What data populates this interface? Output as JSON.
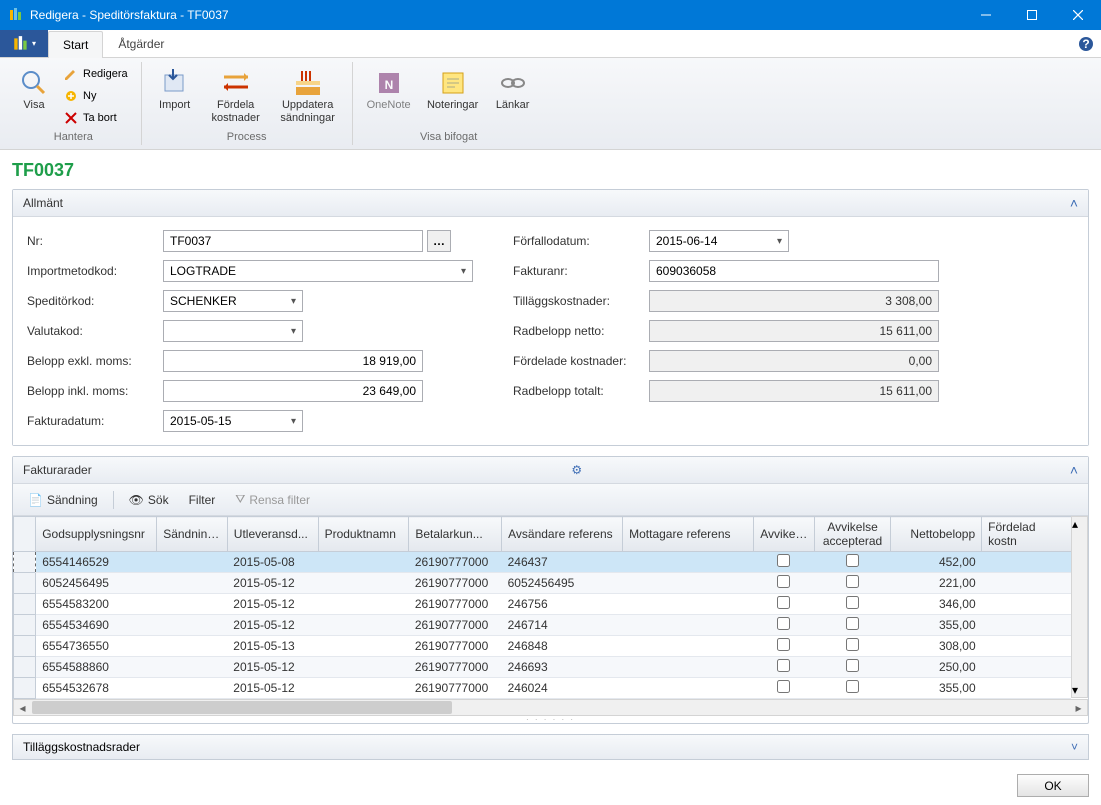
{
  "window": {
    "title": "Redigera - Speditörsfaktura - TF0037"
  },
  "ribbon": {
    "tabs": {
      "start": "Start",
      "actions": "Åtgärder"
    },
    "groups": {
      "hantera": "Hantera",
      "process": "Process",
      "visa_bifogat": "Visa bifogat"
    },
    "buttons": {
      "visa": "Visa",
      "redigera": "Redigera",
      "ny": "Ny",
      "ta_bort": "Ta bort",
      "import": "Import",
      "fordela_kostnader": "Fördela\nkostnader",
      "uppdatera_sandningar": "Uppdatera\nsändningar",
      "onenote": "OneNote",
      "noteringar": "Noteringar",
      "lankar": "Länkar"
    }
  },
  "doc_title": "TF0037",
  "sections": {
    "allmant": "Allmänt",
    "fakturarader": "Fakturarader",
    "tillagg": "Tilläggskostnadsrader"
  },
  "form": {
    "labels": {
      "nr": "Nr:",
      "importmetodkod": "Importmetodkod:",
      "speditorkod": "Speditörkod:",
      "valutakod": "Valutakod:",
      "belopp_exkl": "Belopp exkl. moms:",
      "belopp_inkl": "Belopp inkl. moms:",
      "fakturadatum": "Fakturadatum:",
      "forfallodatum": "Förfallodatum:",
      "fakturanr": "Fakturanr:",
      "tillagg": "Tilläggskostnader:",
      "radbelopp_netto": "Radbelopp netto:",
      "fordelade": "Fördelade kostnader:",
      "radbelopp_totalt": "Radbelopp totalt:"
    },
    "values": {
      "nr": "TF0037",
      "importmetodkod": "LOGTRADE",
      "speditorkod": "SCHENKER",
      "valutakod": "",
      "belopp_exkl": "18 919,00",
      "belopp_inkl": "23 649,00",
      "fakturadatum": "2015-05-15",
      "forfallodatum": "2015-06-14",
      "fakturanr": "609036058",
      "tillagg": "3 308,00",
      "radbelopp_netto": "15 611,00",
      "fordelade": "0,00",
      "radbelopp_totalt": "15 611,00"
    }
  },
  "grid": {
    "toolbar": {
      "sandning": "Sändning",
      "sok": "Sök",
      "filter": "Filter",
      "rensa": "Rensa filter"
    },
    "columns": {
      "godsupplysningsnr": "Godsupplysningsnr",
      "sandning": "Sändning...",
      "utleveransd": "Utleveransd...",
      "produktnamn": "Produktnamn",
      "betalarkun": "Betalarkun...",
      "avsandare_ref": "Avsändare referens",
      "mottagare_ref": "Mottagare referens",
      "avvikelse": "Avvikelse",
      "avvikelse_acc": "Avvikelse accepterad",
      "nettobelopp": "Nettobelopp",
      "fordelad_kostn": "Fördelad kostn"
    },
    "rows": [
      {
        "gods": "6554146529",
        "sand": "",
        "utlev": "2015-05-08",
        "prod": "",
        "betal": "26190777000",
        "avs": "246437",
        "mott": "",
        "avv": false,
        "avvacc": false,
        "netto": "452,00",
        "ford": ""
      },
      {
        "gods": "6052456495",
        "sand": "",
        "utlev": "2015-05-12",
        "prod": "",
        "betal": "26190777000",
        "avs": "6052456495",
        "mott": "",
        "avv": false,
        "avvacc": false,
        "netto": "221,00",
        "ford": ""
      },
      {
        "gods": "6554583200",
        "sand": "",
        "utlev": "2015-05-12",
        "prod": "",
        "betal": "26190777000",
        "avs": "246756",
        "mott": "",
        "avv": false,
        "avvacc": false,
        "netto": "346,00",
        "ford": ""
      },
      {
        "gods": "6554534690",
        "sand": "",
        "utlev": "2015-05-12",
        "prod": "",
        "betal": "26190777000",
        "avs": "246714",
        "mott": "",
        "avv": false,
        "avvacc": false,
        "netto": "355,00",
        "ford": ""
      },
      {
        "gods": "6554736550",
        "sand": "",
        "utlev": "2015-05-13",
        "prod": "",
        "betal": "26190777000",
        "avs": "246848",
        "mott": "",
        "avv": false,
        "avvacc": false,
        "netto": "308,00",
        "ford": ""
      },
      {
        "gods": "6554588860",
        "sand": "",
        "utlev": "2015-05-12",
        "prod": "",
        "betal": "26190777000",
        "avs": "246693",
        "mott": "",
        "avv": false,
        "avvacc": false,
        "netto": "250,00",
        "ford": ""
      },
      {
        "gods": "6554532678",
        "sand": "",
        "utlev": "2015-05-12",
        "prod": "",
        "betal": "26190777000",
        "avs": "246024",
        "mott": "",
        "avv": false,
        "avvacc": false,
        "netto": "355,00",
        "ford": ""
      }
    ]
  },
  "footer": {
    "ok": "OK"
  }
}
